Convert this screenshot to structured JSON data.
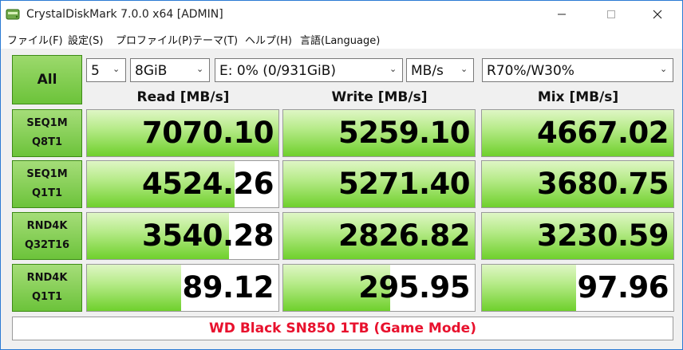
{
  "window": {
    "title": "CrystalDiskMark 7.0.0 x64 [ADMIN]"
  },
  "menu": [
    "ファイル(F)",
    "設定(S)",
    "プロファイル(P)",
    "テーマ(T)",
    "ヘルプ(H)",
    "言語(Language)"
  ],
  "controls": {
    "all_label": "All",
    "count": "5",
    "size": "8GiB",
    "drive": "E: 0% (0/931GiB)",
    "unit": "MB/s",
    "mix": "R70%/W30%"
  },
  "headers": {
    "read": "Read [MB/s]",
    "write": "Write [MB/s]",
    "mix": "Mix [MB/s]"
  },
  "rows": [
    {
      "line1": "SEQ1M",
      "line2": "Q8T1",
      "read": {
        "value": "7070.10",
        "level": 1.0
      },
      "write": {
        "value": "5259.10",
        "level": 1.0
      },
      "mix": {
        "value": "4667.02",
        "level": 1.0
      }
    },
    {
      "line1": "SEQ1M",
      "line2": "Q1T1",
      "read": {
        "value": "4524.26",
        "level": 0.77
      },
      "write": {
        "value": "5271.40",
        "level": 1.0
      },
      "mix": {
        "value": "3680.75",
        "level": 1.0
      }
    },
    {
      "line1": "RND4K",
      "line2": "Q32T16",
      "read": {
        "value": "3540.28",
        "level": 0.74
      },
      "write": {
        "value": "2826.82",
        "level": 1.0
      },
      "mix": {
        "value": "3230.59",
        "level": 1.0
      }
    },
    {
      "line1": "RND4K",
      "line2": "Q1T1",
      "read": {
        "value": "89.12",
        "level": 0.49
      },
      "write": {
        "value": "295.95",
        "level": 0.56
      },
      "mix": {
        "value": "97.96",
        "level": 0.49
      }
    }
  ],
  "comment": "WD Black SN850 1TB (Game Mode)",
  "colors": {
    "comment_text": "#e8112d",
    "accent_green": "#6cc33a",
    "window_border": "#2b7bd4"
  }
}
